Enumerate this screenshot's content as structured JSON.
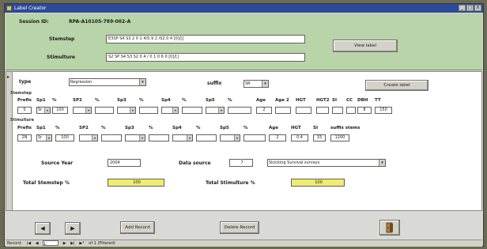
{
  "window": {
    "title": "Label Creator",
    "buttons": [
      "_",
      "□",
      "X"
    ]
  },
  "header": {
    "session_label": "Session ID:",
    "session_value": "RPA-A10105-789-002-A",
    "stemstep_label": "Stemstep",
    "stemstep_value": "E3SP S4 S3 2 0 1 4/S 9 2 /S2 0 4 [0]/[]",
    "stimulture_label": "Stimulture",
    "stimulture_value": "S2 SP S4 S3 S2 0 4 / 0 1 0 6 0 [0]/[]",
    "view_button": "View label"
  },
  "controls": {
    "type_label": "type",
    "type_value": "Regression",
    "suffix_label": "suffix",
    "suffix_value": "SR",
    "create_button": "Create label"
  },
  "stemstep_section": {
    "title": "Stemstep",
    "headers": [
      "Prefix",
      "Sp1",
      "%",
      "SP2",
      "%",
      "Sp3",
      "%",
      "Sp4",
      "%",
      "Sp5",
      "%",
      "Age",
      "Age 2",
      "HGT",
      "HGT2",
      "SI",
      "CC",
      "DBH",
      "TT"
    ],
    "cells": [
      "S",
      "Sr",
      "100",
      "",
      "",
      "",
      "",
      "",
      "",
      "",
      "",
      "2",
      "",
      "",
      "",
      "",
      "",
      "8",
      "150"
    ]
  },
  "stimulture_section": {
    "title": "Stimulture",
    "headers": [
      "Prefix",
      "Sp1",
      "%",
      "SP2",
      "%",
      "Sp3",
      "%",
      "Sp4",
      "%",
      "Sp5",
      "%",
      "Age",
      "HGT",
      "SI",
      "suffix stems"
    ],
    "cells": [
      "2N",
      "Sr",
      "100",
      "",
      "",
      "",
      "",
      "",
      "",
      "",
      "",
      "2",
      "0.4",
      "15",
      "1200"
    ]
  },
  "source": {
    "year_label": "Source Year",
    "year_value": "2004",
    "data_label": "Data source",
    "data_value": "7",
    "data_desc": "Stocking Survival surveys"
  },
  "totals": {
    "stemstep_label": "Total Stemstep %",
    "stemstep_value": "100",
    "stimulture_label": "Total Stimulture %",
    "stimulture_value": "100"
  },
  "footer": {
    "prev_arrow": "◀",
    "next_arrow": "▶",
    "add_button": "Add Record",
    "delete_button": "Delete Record",
    "exit_icon": "exit-door-icon"
  },
  "record_nav": {
    "label": "Record:",
    "first": "|◀",
    "prev": "◀",
    "current": "1",
    "next": "▶",
    "last": "▶|",
    "new": "▶*",
    "of": "of 1 (Filtered)"
  }
}
